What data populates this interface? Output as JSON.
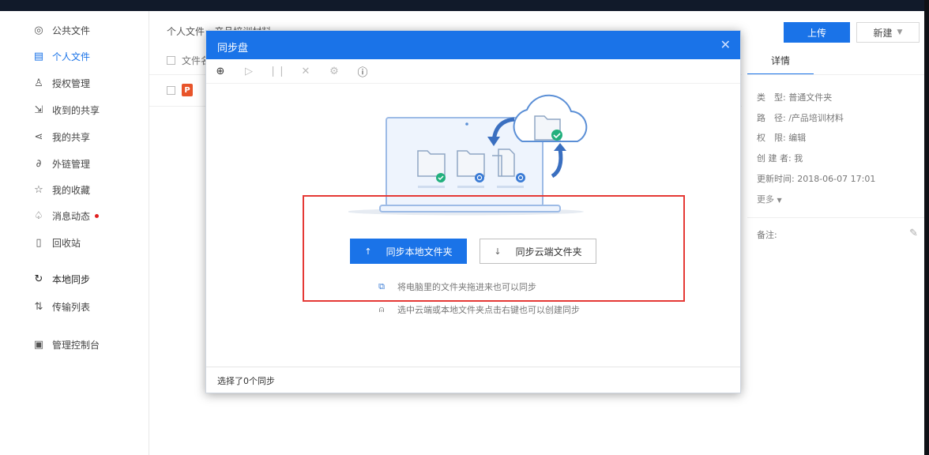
{
  "sidebar": {
    "items": [
      {
        "label": "公共文件",
        "icon": "public-files-icon"
      },
      {
        "label": "个人文件",
        "icon": "personal-files-icon",
        "active": true
      },
      {
        "label": "授权管理",
        "icon": "authorization-icon"
      },
      {
        "label": "收到的共享",
        "icon": "received-share-icon"
      },
      {
        "label": "我的共享",
        "icon": "my-share-icon"
      },
      {
        "label": "外链管理",
        "icon": "external-link-icon"
      },
      {
        "label": "我的收藏",
        "icon": "star-icon"
      },
      {
        "label": "消息动态",
        "icon": "bell-icon",
        "badge": true
      },
      {
        "label": "回收站",
        "icon": "trash-icon"
      },
      {
        "label": "本地同步",
        "icon": "sync-icon"
      },
      {
        "label": "传输列表",
        "icon": "transfer-icon"
      },
      {
        "label": "管理控制台",
        "icon": "console-icon"
      }
    ]
  },
  "main": {
    "breadcrumb": "个人文件 › 产品培训材料",
    "col_name": "文件名",
    "row_badge": "P"
  },
  "right_panel": {
    "upload": "上传",
    "new": "新建",
    "tab_detail": "详情",
    "info": [
      {
        "k": "类　型:",
        "v": "普通文件夹"
      },
      {
        "k": "路　径:",
        "v": "/产品培训材料"
      },
      {
        "k": "权　限:",
        "v": "编辑"
      },
      {
        "k": "创 建 者:",
        "v": "我"
      },
      {
        "k": "更新时间:",
        "v": "2018-06-07 17:01"
      }
    ],
    "more": "更多",
    "note": "备注:"
  },
  "dialog": {
    "title": "同步盘",
    "btn_local": "同步本地文件夹",
    "btn_cloud": "同步云端文件夹",
    "hint1": "将电脑里的文件夹拖进来也可以同步",
    "hint2": "选中云端或本地文件夹点击右键也可以创建同步",
    "footer": "选择了0个同步"
  },
  "colors": {
    "accent": "#1a73e8",
    "highlight_box": "#e53935"
  }
}
